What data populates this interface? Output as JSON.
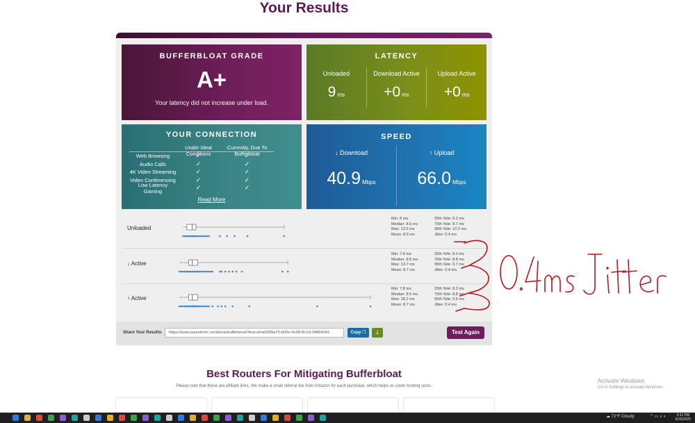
{
  "page": {
    "title": "Your Results"
  },
  "grade": {
    "title": "BUFFERBLOAT GRADE",
    "value": "A+",
    "message": "Your latency did not increase under load."
  },
  "latency": {
    "title": "LATENCY",
    "unit": "ms",
    "cols": [
      {
        "label": "Unloaded",
        "value": "9"
      },
      {
        "label": "Download Active",
        "value": "+0"
      },
      {
        "label": "Upload Active",
        "value": "+0"
      }
    ]
  },
  "connection": {
    "title": "YOUR CONNECTION",
    "col_ideal": "Under Ideal Conditions",
    "col_current": "Currently, Due To Bufferbloat",
    "rows": [
      {
        "label": "Web Browsing",
        "ideal": "✓",
        "current": "✓"
      },
      {
        "label": "Audio Calls",
        "ideal": "✓",
        "current": "✓"
      },
      {
        "label": "4K Video Streaming",
        "ideal": "✓",
        "current": "✓"
      },
      {
        "label": "Video Conferencing",
        "ideal": "✓",
        "current": "✓"
      },
      {
        "label": "Low Latency Gaming",
        "ideal": "✓",
        "current": "✓"
      }
    ],
    "read_more": "Read More"
  },
  "speed": {
    "title": "SPEED",
    "unit": "Mbps",
    "download_label": "↓ Download",
    "download_value": "40.9",
    "upload_label": "↑ Upload",
    "upload_value": "66.0"
  },
  "plots": [
    {
      "name": "Unloaded",
      "stats_left": [
        "Min: 8 ms",
        "Median: 8.5 ms",
        "Max: 13.5 ms",
        "Mean: 8.6 ms"
      ],
      "stats_right": [
        "25th %ile: 8.2 ms",
        "75th %ile: 8.7 ms",
        "95th %ile: 10.2 ms",
        "Jitter: 0.4 ms"
      ],
      "box": {
        "min": 8.0,
        "q1": 8.2,
        "median": 8.5,
        "q3": 8.7,
        "max": 13.5
      },
      "dots": [
        8.0,
        8.1,
        8.1,
        8.2,
        8.2,
        8.3,
        8.3,
        8.4,
        8.4,
        8.5,
        8.5,
        8.6,
        8.6,
        8.7,
        8.7,
        8.8,
        8.9,
        9.0,
        9.1,
        9.2,
        9.3,
        9.4,
        10.0,
        10.4,
        10.8,
        11.5,
        13.5
      ]
    },
    {
      "name": "↓ Active",
      "stats_left": [
        "Min: 7.8 ms",
        "Median: 8.5 ms",
        "Max: 13.7 ms",
        "Mean: 8.7 ms"
      ],
      "stats_right": [
        "25th %ile: 8.3 ms",
        "75th %ile: 8.8 ms",
        "95th %ile: 9.7 ms",
        "Jitter: 0.4 ms"
      ],
      "box": {
        "min": 7.8,
        "q1": 8.3,
        "median": 8.5,
        "q3": 8.8,
        "max": 13.7
      },
      "dots": [
        7.8,
        7.9,
        8.0,
        8.1,
        8.2,
        8.2,
        8.3,
        8.3,
        8.4,
        8.4,
        8.5,
        8.5,
        8.6,
        8.6,
        8.7,
        8.7,
        8.8,
        8.8,
        8.9,
        9.0,
        9.1,
        9.2,
        9.3,
        9.4,
        9.5,
        9.6,
        10.0,
        10.1,
        10.3,
        10.5,
        10.7,
        10.9,
        11.2,
        13.4,
        13.7
      ]
    },
    {
      "name": "↑ Active",
      "stats_left": [
        "Min: 7.8 ms",
        "Median: 8.5 ms",
        "Max: 18.2 ms",
        "Mean: 8.7 ms"
      ],
      "stats_right": [
        "25th %ile: 8.3 ms",
        "75th %ile: 8.8 ms",
        "95th %ile: 9.5 ms",
        "Jitter: 0.4 ms"
      ],
      "box": {
        "min": 7.8,
        "q1": 8.3,
        "median": 8.5,
        "q3": 8.8,
        "max": 18.2
      },
      "dots": [
        7.8,
        7.9,
        8.0,
        8.1,
        8.2,
        8.2,
        8.3,
        8.3,
        8.4,
        8.4,
        8.5,
        8.5,
        8.6,
        8.6,
        8.7,
        8.7,
        8.8,
        8.8,
        8.9,
        9.0,
        9.1,
        9.2,
        9.3,
        9.4,
        9.6,
        9.9,
        10.1,
        10.3,
        10.7,
        11.6,
        15.3,
        18.2
      ]
    }
  ],
  "plot_axis": {
    "min_ms": 7.0,
    "max_ms": 18.5
  },
  "share": {
    "label": "Share Your Results:",
    "url": "https://www.waveform.com/tools/bufferbloat?test-id=a0999a70-b06e-4c99-8c1d-34864341",
    "copy_label": "Copy",
    "download_icon": "download-icon",
    "test_again": "Test Again"
  },
  "annotation": {
    "text": "0.4ms Jitter",
    "color": "#c0121c"
  },
  "routers": {
    "title": "Best Routers For Mitigating Bufferbloat",
    "note": "Please note that these are affiliate links. We make a small referral fee from Amazon for each purchase, which helps us cover hosting costs."
  },
  "watermark": {
    "line1": "Activate Windows",
    "line2": "Go to Settings to activate Windows."
  },
  "taskbar": {
    "weather": "72°F  Cloudy",
    "time": "5:11 PM",
    "date": "6/26/2025",
    "icons": [
      "windows-start-icon",
      "search-icon",
      "chrome-icon",
      "firefox-icon",
      "folder-icon",
      "xbox-icon",
      "steam-icon",
      "terminal-icon",
      "photos-icon",
      "mail-icon",
      "app-icon",
      "outlook-icon",
      "chrome-icon",
      "edge-icon",
      "vpn-icon",
      "word-icon",
      "notepad-icon",
      "music-icon",
      "app-icon",
      "app-icon",
      "steam-icon",
      "discord-icon",
      "settings-icon",
      "app-icon",
      "app-icon",
      "app-icon",
      "calculator-icon"
    ]
  },
  "colors": {
    "accent": "#6d1c5e",
    "grade_bg": "#6e1e58",
    "latency_bg": "#7c8f18",
    "connection_bg": "#3b8586",
    "speed_bg": "#1f74b0",
    "dot": "#3f86c9"
  }
}
